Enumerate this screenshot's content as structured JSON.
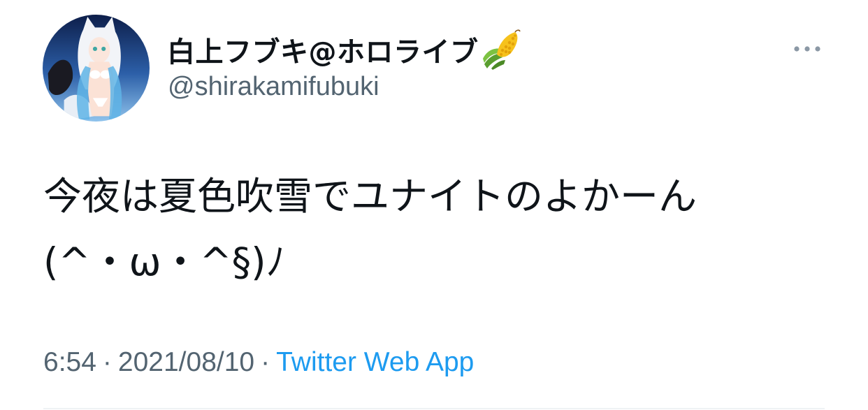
{
  "user": {
    "display_name": "白上フブキ@ホロライブ",
    "name_emoji": "corn-emoji",
    "handle": "@shirakamifubuki"
  },
  "tweet": {
    "text_line_1": "今夜は夏色吹雪でユナイトのよかーん",
    "text_line_2": "(^・ω・^§)ﾉ"
  },
  "meta": {
    "time": "6:54",
    "separator": "·",
    "date": "2021/08/10",
    "source": "Twitter Web App"
  },
  "colors": {
    "text_primary": "#0f1419",
    "text_secondary": "#536471",
    "link": "#1d9bf0",
    "divider": "#eff3f4"
  },
  "icons": {
    "more": "more-horizontal-icon"
  }
}
